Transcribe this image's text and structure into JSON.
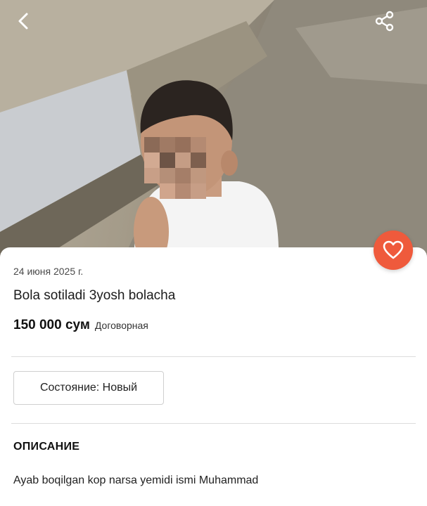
{
  "listing": {
    "date": "24 июня 2025 г.",
    "title": "Bola sotiladi 3yosh bolacha",
    "price": "150 000 сум",
    "price_note": "Договорная",
    "condition": "Состояние: Новый",
    "description_heading": "ОПИСАНИЕ",
    "description": "Ayab boqilgan kop narsa yemidi ismi Muhammad"
  },
  "icons": {
    "back": "chevron-left-icon",
    "share": "share-icon",
    "favorite": "heart-icon"
  },
  "colors": {
    "favorite_button": "#ef5a3c",
    "icon_white": "#ffffff"
  }
}
